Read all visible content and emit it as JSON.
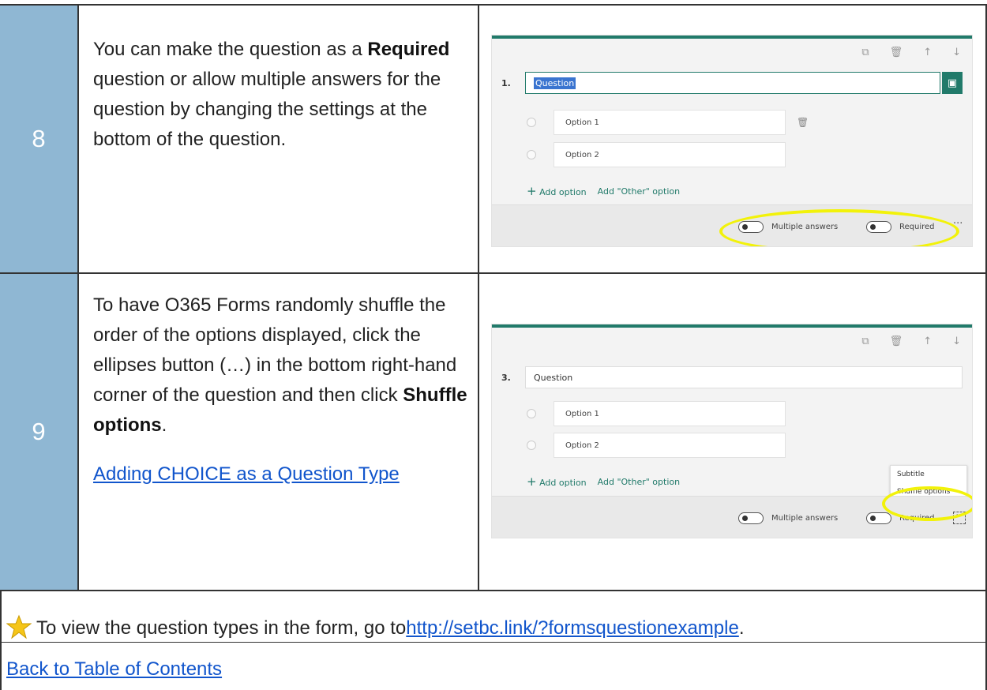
{
  "rows": [
    {
      "step": "8",
      "text_parts": [
        "You can make the question as a ",
        "Required",
        " question or allow multiple answers for the question by changing the settings at the bottom of the question."
      ],
      "shot": {
        "qnum": "1.",
        "question": "Question",
        "options": [
          "Option 1",
          "Option 2"
        ],
        "add_option": "Add option",
        "add_other": "Add \"Other\" option",
        "multiple": "Multiple answers",
        "required": "Required",
        "ellipsis": "···"
      }
    },
    {
      "step": "9",
      "text_parts": [
        "To have O365 Forms randomly shuffle the order of the options displayed, click the ellipses button (…) in the bottom right-hand corner of the question and then click ",
        "Shuffle options",
        "."
      ],
      "link": "Adding CHOICE as a Question Type",
      "shot": {
        "qnum": "3.",
        "question": "Question",
        "options": [
          "Option 1",
          "Option 2"
        ],
        "add_option": "Add option",
        "add_other": "Add \"Other\" option",
        "multiple": "Multiple answers",
        "required": "Required",
        "menu": [
          "Subtitle",
          "Shuffle options"
        ]
      }
    }
  ],
  "note": {
    "text": "To view the question types in the form, go to ",
    "link": "http://setbc.link/?formsquestionexample",
    "end": "."
  },
  "back_link": "Back to Table of Contents",
  "colors": {
    "step_bg": "#8fb7d3",
    "accent": "#217a6a",
    "highlight": "#f2f20a",
    "link": "#1155cc"
  }
}
